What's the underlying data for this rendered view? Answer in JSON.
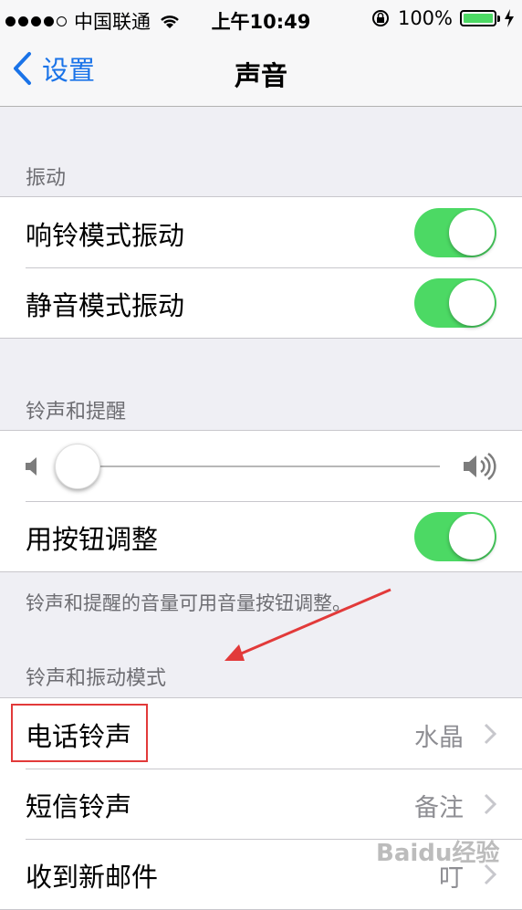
{
  "status_bar": {
    "carrier": "中国联通",
    "time": "上午10:49",
    "battery_percent": "100%",
    "signal_bars_filled": 4,
    "signal_bars_total": 5
  },
  "nav": {
    "back_label": "设置",
    "title": "声音"
  },
  "sections": {
    "vibrate_header": "振动",
    "vibrate_on_ring": "响铃模式振动",
    "vibrate_on_silent": "静音模式振动",
    "ringer_header": "铃声和提醒",
    "ringer_volume_level": 0.05,
    "change_with_buttons": "用按钮调整",
    "ringer_footer": "铃声和提醒的音量可用音量按钮调整。",
    "sounds_header": "铃声和振动模式",
    "ringtone_label": "电话铃声",
    "ringtone_value": "水晶",
    "text_tone_label": "短信铃声",
    "text_tone_value": "备注",
    "new_mail_label": "收到新邮件",
    "new_mail_value": "叮"
  },
  "toggles": {
    "vibrate_on_ring": true,
    "vibrate_on_silent": true,
    "change_with_buttons": true
  },
  "colors": {
    "toggle_on": "#4cd964",
    "accent": "#1a73e8",
    "annotation": "#e23a3a"
  },
  "watermark": "Baidu经验"
}
